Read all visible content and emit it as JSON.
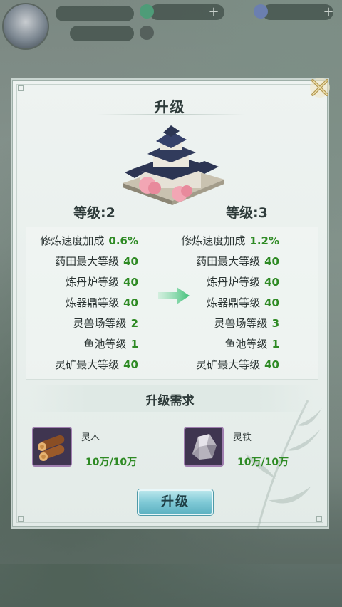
{
  "panel": {
    "title": "升级",
    "current_level": "等级:2",
    "next_level": "等级:3",
    "upgrade_button": "升级"
  },
  "stats": {
    "current": [
      {
        "label": "修炼速度加成",
        "value": "0.6%"
      },
      {
        "label": "药田最大等级",
        "value": "40"
      },
      {
        "label": "炼丹炉等级",
        "value": "40"
      },
      {
        "label": "炼器鼎等级",
        "value": "40"
      },
      {
        "label": "灵兽场等级",
        "value": "2"
      },
      {
        "label": "鱼池等级",
        "value": "1"
      },
      {
        "label": "灵矿最大等级",
        "value": "40"
      }
    ],
    "next": [
      {
        "label": "修炼速度加成",
        "value": "1.2%"
      },
      {
        "label": "药田最大等级",
        "value": "40"
      },
      {
        "label": "炼丹炉等级",
        "value": "40"
      },
      {
        "label": "炼器鼎等级",
        "value": "40"
      },
      {
        "label": "灵兽场等级",
        "value": "3"
      },
      {
        "label": "鱼池等级",
        "value": "1"
      },
      {
        "label": "灵矿最大等级",
        "value": "40"
      }
    ]
  },
  "requirements": {
    "title": "升级需求",
    "items": [
      {
        "name": "灵木",
        "count": "10万/10万",
        "icon": "wood-logs-icon"
      },
      {
        "name": "灵铁",
        "count": "10万/10万",
        "icon": "iron-ore-icon"
      }
    ]
  },
  "colors": {
    "value_green": "#2e8a24",
    "button_teal": "#7fc9d6",
    "item_frame": "#a07fb0"
  }
}
